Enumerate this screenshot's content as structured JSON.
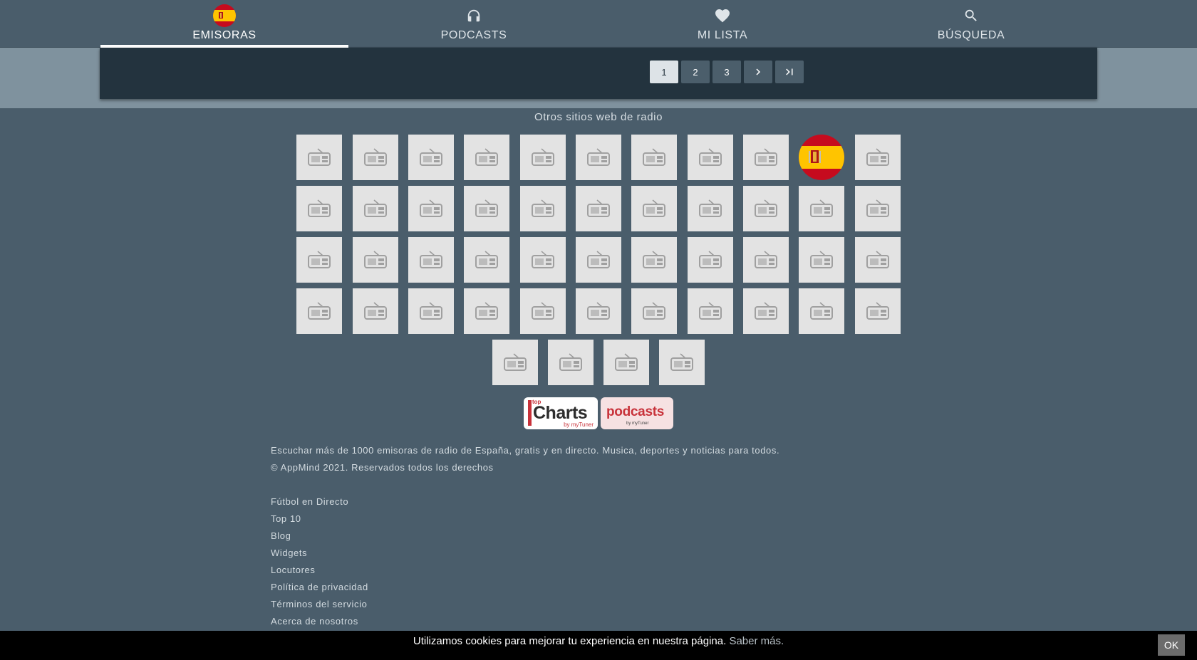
{
  "nav": {
    "tabs": [
      {
        "label": "EMISORAS",
        "icon": "spain-flag-icon",
        "active": true
      },
      {
        "label": "PODCASTS",
        "icon": "headphones-icon",
        "active": false
      },
      {
        "label": "MI LISTA",
        "icon": "heart-icon",
        "active": false
      },
      {
        "label": "BÚSQUEDA",
        "icon": "search-icon",
        "active": false
      }
    ]
  },
  "pagination": {
    "pages": [
      "1",
      "2",
      "3"
    ],
    "current_page": "1",
    "next_icon": "chevron-right-icon",
    "last_icon": "last-page-icon"
  },
  "other_sites": {
    "title": "Otros sitios web de radio",
    "tile_icon": "radio-icon",
    "highlighted_icon": "spain-flag-icon"
  },
  "badges": {
    "charts": {
      "top": "top",
      "main": "Charts",
      "by": "by myTuner"
    },
    "podcasts": {
      "main": "podcasts",
      "by": "by myTuner"
    }
  },
  "footer": {
    "description": "Escuchar más de 1000 emisoras de radio de España, gratis y en directo. Musica, deportes y noticias para todos.",
    "copyright": "© AppMind 2021. Reservados todos los derechos",
    "links": [
      "Fútbol en Directo",
      "Top 10",
      "Blog",
      "Widgets",
      "Locutores",
      "Política de privacidad",
      "Términos del servicio",
      "Acerca de nosotros"
    ]
  },
  "cookie": {
    "text": "Utilizamos cookies para mejorar tu experiencia en nuestra página.",
    "more": "Saber más.",
    "ok": "OK"
  },
  "colors": {
    "background": "#4a5d6b",
    "pager_band": "#7f929e",
    "pager_box": "#23333e",
    "tile": "#e3e3e3",
    "brand_red": "#c8323a"
  }
}
